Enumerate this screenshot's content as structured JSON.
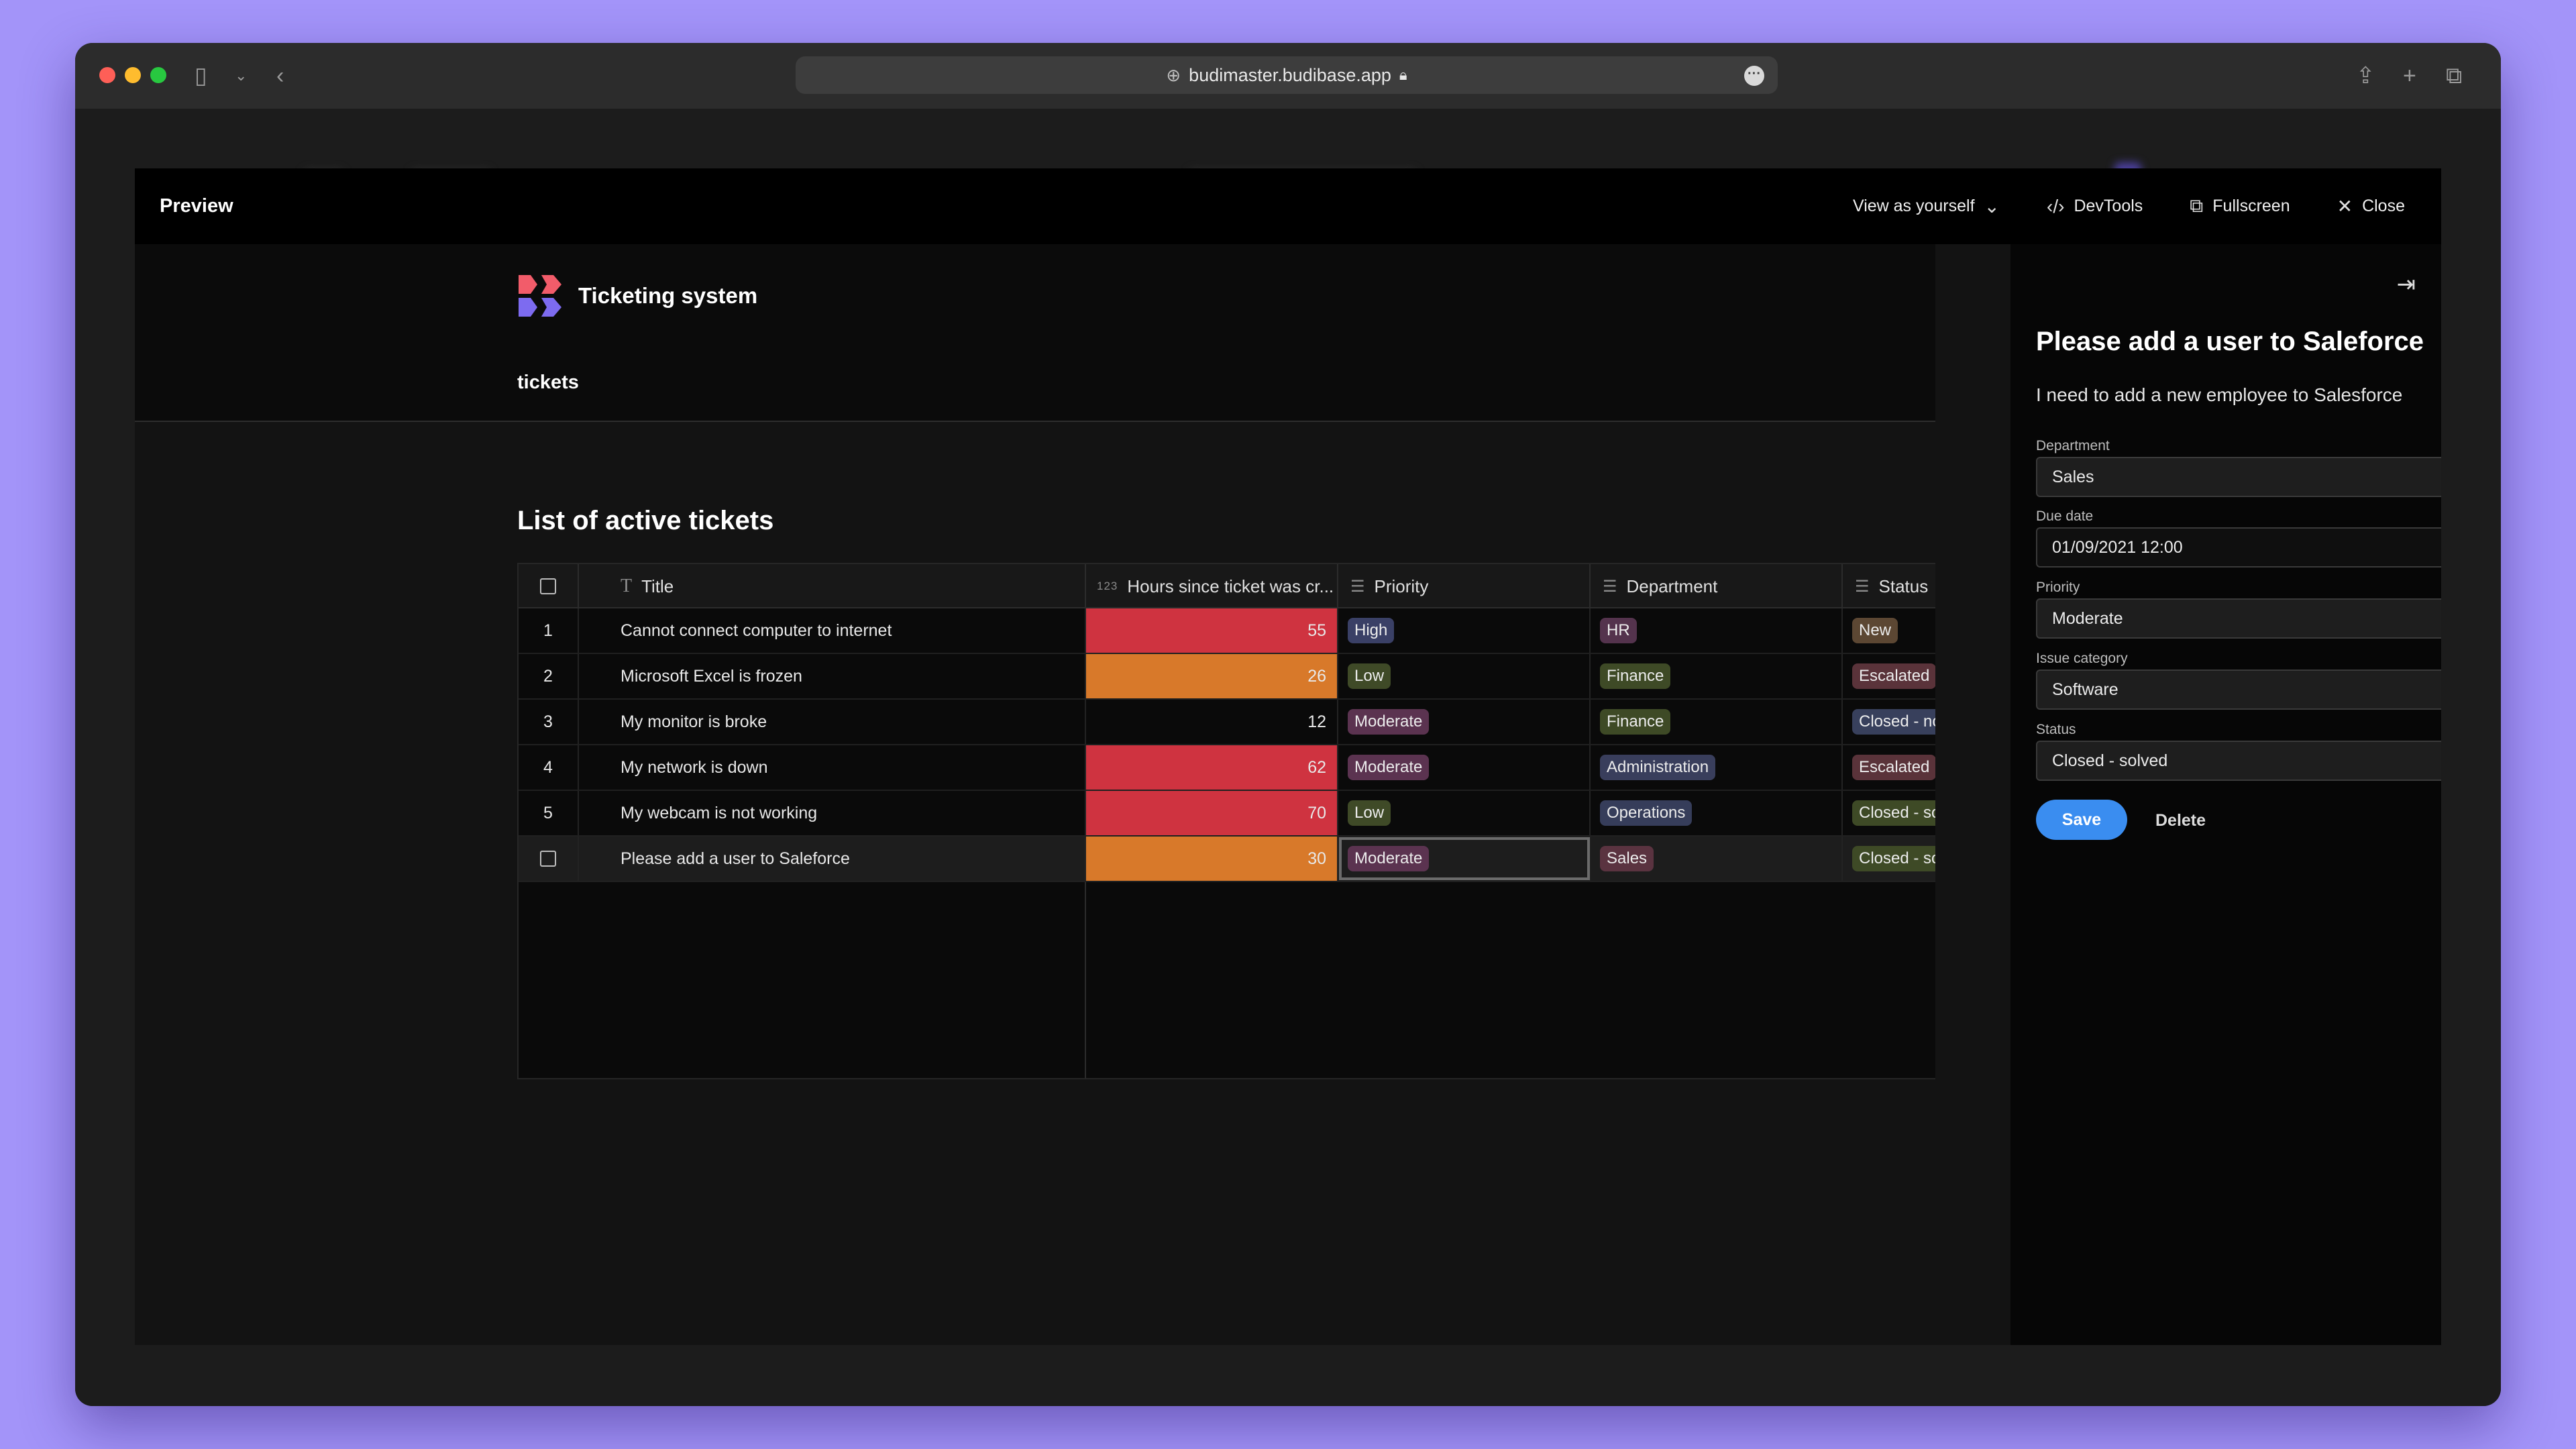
{
  "browser": {
    "url": "budimaster.budibase.app"
  },
  "preview": {
    "title": "Preview",
    "view_as": "View as yourself",
    "devtools": "DevTools",
    "fullscreen": "Fullscreen",
    "close": "Close"
  },
  "app": {
    "name": "Ticketing system",
    "nav_link": "tickets",
    "section_title": "List of active tickets"
  },
  "table": {
    "columns": {
      "title": "Title",
      "hours_type": "123",
      "hours": "Hours since ticket was cr...",
      "priority": "Priority",
      "department": "Department",
      "status": "Status"
    },
    "rows": [
      {
        "index": "1",
        "title": "Cannot connect computer to internet",
        "hours": "55",
        "priority": "High",
        "department": "HR",
        "status": "New"
      },
      {
        "index": "2",
        "title": "Microsoft Excel is frozen",
        "hours": "26",
        "priority": "Low",
        "department": "Finance",
        "status": "Escalated"
      },
      {
        "index": "3",
        "title": "My monitor is broke",
        "hours": "12",
        "priority": "Moderate",
        "department": "Finance",
        "status": "Closed - not solved"
      },
      {
        "index": "4",
        "title": "My network is down",
        "hours": "62",
        "priority": "Moderate",
        "department": "Administration",
        "status": "Escalated"
      },
      {
        "index": "5",
        "title": "My webcam is not working",
        "hours": "70",
        "priority": "Low",
        "department": "Operations",
        "status": "Closed - solved"
      },
      {
        "index": "",
        "title": "Please add a user to Saleforce",
        "hours": "30",
        "priority": "Moderate",
        "department": "Sales",
        "status": "Closed - solved"
      }
    ],
    "colors": {
      "hours_high": "#cf3340",
      "hours_mid": "#d8792a",
      "pill_high": "#3a4066",
      "pill_low": "#3f4a27",
      "pill_moderate": "#5b3350",
      "pill_hr": "#54334d",
      "pill_finance": "#3e4a26",
      "pill_admin": "#393e5c",
      "pill_ops": "#363d5a",
      "pill_sales": "#5a3340",
      "pill_new": "#5c4733",
      "pill_escalated": "#5a333a",
      "pill_not_solved": "#38405c",
      "pill_solved": "#3e4a26"
    }
  },
  "side_panel": {
    "title": "Please add a user to Saleforce",
    "description": "I need to add a new employee to Salesforce",
    "department_label": "Department",
    "department_value": "Sales",
    "due_date_label": "Due date",
    "due_date_value": "01/09/2021 12:00",
    "priority_label": "Priority",
    "priority_value": "Moderate",
    "issue_category_label": "Issue category",
    "issue_category_value": "Software",
    "status_label": "Status",
    "status_value": "Closed - solved",
    "save": "Save",
    "delete": "Delete"
  }
}
